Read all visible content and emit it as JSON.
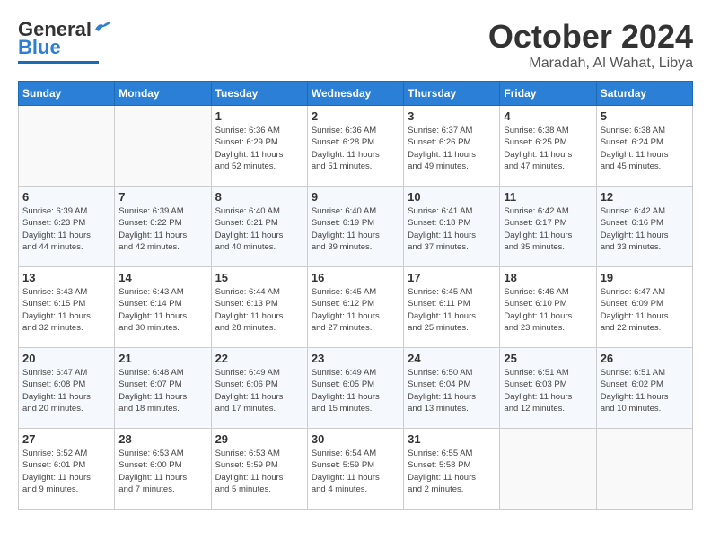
{
  "header": {
    "logo_general": "General",
    "logo_blue": "Blue",
    "month": "October 2024",
    "location": "Maradah, Al Wahat, Libya"
  },
  "weekdays": [
    "Sunday",
    "Monday",
    "Tuesday",
    "Wednesday",
    "Thursday",
    "Friday",
    "Saturday"
  ],
  "weeks": [
    [
      {
        "day": "",
        "info": ""
      },
      {
        "day": "",
        "info": ""
      },
      {
        "day": "1",
        "info": "Sunrise: 6:36 AM\nSunset: 6:29 PM\nDaylight: 11 hours\nand 52 minutes."
      },
      {
        "day": "2",
        "info": "Sunrise: 6:36 AM\nSunset: 6:28 PM\nDaylight: 11 hours\nand 51 minutes."
      },
      {
        "day": "3",
        "info": "Sunrise: 6:37 AM\nSunset: 6:26 PM\nDaylight: 11 hours\nand 49 minutes."
      },
      {
        "day": "4",
        "info": "Sunrise: 6:38 AM\nSunset: 6:25 PM\nDaylight: 11 hours\nand 47 minutes."
      },
      {
        "day": "5",
        "info": "Sunrise: 6:38 AM\nSunset: 6:24 PM\nDaylight: 11 hours\nand 45 minutes."
      }
    ],
    [
      {
        "day": "6",
        "info": "Sunrise: 6:39 AM\nSunset: 6:23 PM\nDaylight: 11 hours\nand 44 minutes."
      },
      {
        "day": "7",
        "info": "Sunrise: 6:39 AM\nSunset: 6:22 PM\nDaylight: 11 hours\nand 42 minutes."
      },
      {
        "day": "8",
        "info": "Sunrise: 6:40 AM\nSunset: 6:21 PM\nDaylight: 11 hours\nand 40 minutes."
      },
      {
        "day": "9",
        "info": "Sunrise: 6:40 AM\nSunset: 6:19 PM\nDaylight: 11 hours\nand 39 minutes."
      },
      {
        "day": "10",
        "info": "Sunrise: 6:41 AM\nSunset: 6:18 PM\nDaylight: 11 hours\nand 37 minutes."
      },
      {
        "day": "11",
        "info": "Sunrise: 6:42 AM\nSunset: 6:17 PM\nDaylight: 11 hours\nand 35 minutes."
      },
      {
        "day": "12",
        "info": "Sunrise: 6:42 AM\nSunset: 6:16 PM\nDaylight: 11 hours\nand 33 minutes."
      }
    ],
    [
      {
        "day": "13",
        "info": "Sunrise: 6:43 AM\nSunset: 6:15 PM\nDaylight: 11 hours\nand 32 minutes."
      },
      {
        "day": "14",
        "info": "Sunrise: 6:43 AM\nSunset: 6:14 PM\nDaylight: 11 hours\nand 30 minutes."
      },
      {
        "day": "15",
        "info": "Sunrise: 6:44 AM\nSunset: 6:13 PM\nDaylight: 11 hours\nand 28 minutes."
      },
      {
        "day": "16",
        "info": "Sunrise: 6:45 AM\nSunset: 6:12 PM\nDaylight: 11 hours\nand 27 minutes."
      },
      {
        "day": "17",
        "info": "Sunrise: 6:45 AM\nSunset: 6:11 PM\nDaylight: 11 hours\nand 25 minutes."
      },
      {
        "day": "18",
        "info": "Sunrise: 6:46 AM\nSunset: 6:10 PM\nDaylight: 11 hours\nand 23 minutes."
      },
      {
        "day": "19",
        "info": "Sunrise: 6:47 AM\nSunset: 6:09 PM\nDaylight: 11 hours\nand 22 minutes."
      }
    ],
    [
      {
        "day": "20",
        "info": "Sunrise: 6:47 AM\nSunset: 6:08 PM\nDaylight: 11 hours\nand 20 minutes."
      },
      {
        "day": "21",
        "info": "Sunrise: 6:48 AM\nSunset: 6:07 PM\nDaylight: 11 hours\nand 18 minutes."
      },
      {
        "day": "22",
        "info": "Sunrise: 6:49 AM\nSunset: 6:06 PM\nDaylight: 11 hours\nand 17 minutes."
      },
      {
        "day": "23",
        "info": "Sunrise: 6:49 AM\nSunset: 6:05 PM\nDaylight: 11 hours\nand 15 minutes."
      },
      {
        "day": "24",
        "info": "Sunrise: 6:50 AM\nSunset: 6:04 PM\nDaylight: 11 hours\nand 13 minutes."
      },
      {
        "day": "25",
        "info": "Sunrise: 6:51 AM\nSunset: 6:03 PM\nDaylight: 11 hours\nand 12 minutes."
      },
      {
        "day": "26",
        "info": "Sunrise: 6:51 AM\nSunset: 6:02 PM\nDaylight: 11 hours\nand 10 minutes."
      }
    ],
    [
      {
        "day": "27",
        "info": "Sunrise: 6:52 AM\nSunset: 6:01 PM\nDaylight: 11 hours\nand 9 minutes."
      },
      {
        "day": "28",
        "info": "Sunrise: 6:53 AM\nSunset: 6:00 PM\nDaylight: 11 hours\nand 7 minutes."
      },
      {
        "day": "29",
        "info": "Sunrise: 6:53 AM\nSunset: 5:59 PM\nDaylight: 11 hours\nand 5 minutes."
      },
      {
        "day": "30",
        "info": "Sunrise: 6:54 AM\nSunset: 5:59 PM\nDaylight: 11 hours\nand 4 minutes."
      },
      {
        "day": "31",
        "info": "Sunrise: 6:55 AM\nSunset: 5:58 PM\nDaylight: 11 hours\nand 2 minutes."
      },
      {
        "day": "",
        "info": ""
      },
      {
        "day": "",
        "info": ""
      }
    ]
  ]
}
